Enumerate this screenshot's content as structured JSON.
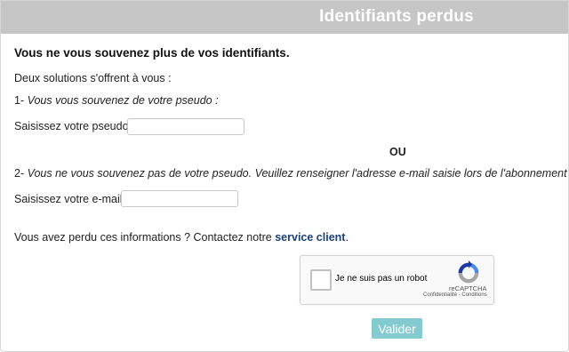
{
  "header": {
    "title": "Identifiants perdus"
  },
  "heading": "Vous ne vous souvenez plus de vos identifiants.",
  "intro": "Deux solutions s'offrent à vous :",
  "option1": {
    "number": "1-",
    "text": "Vous vous souvenez de votre pseudo :"
  },
  "pseudo": {
    "label": "Saisissez votre pseudo :",
    "value": "",
    "placeholder": ""
  },
  "separator": "OU",
  "option2": {
    "number": "2-",
    "text": "Vous ne vous souvenez pas de votre pseudo. Veuillez renseigner l'adresse e-mail saisie lors de l'abonnement :"
  },
  "email": {
    "label": "Saisissez votre e-mail :",
    "value": "",
    "placeholder": ""
  },
  "info": {
    "text": "Vous avez perdu ces informations ? Contactez notre",
    "link": "service client",
    "suffix": "."
  },
  "recaptcha": {
    "label": "Je ne suis pas un robot",
    "brand": "reCAPTCHA",
    "privacy": "Confidentialité",
    "sep": " - ",
    "terms": "Conditions",
    "icon": "recaptcha-logo-icon"
  },
  "submit_label": "Valider",
  "colors": {
    "header_bg": "#c6c6c6",
    "link": "#1c3f78",
    "button": "#83cbcf"
  }
}
